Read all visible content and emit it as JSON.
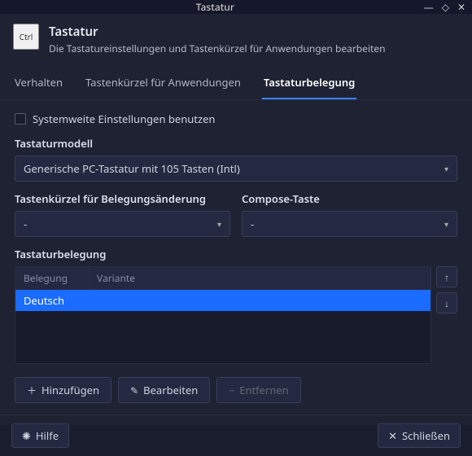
{
  "window": {
    "title": "Tastatur"
  },
  "header": {
    "icon_label": "Ctrl",
    "title": "Tastatur",
    "subtitle": "Die Tastatureinstellungen und Tastenkürzel für Anwendungen bearbeiten"
  },
  "tabs": [
    {
      "label": "Verhalten"
    },
    {
      "label": "Tastenkürzel für Anwendungen"
    },
    {
      "label": "Tastaturbelegung"
    }
  ],
  "active_tab": 2,
  "checkbox": {
    "label": "Systemweite Einstellungen benutzen",
    "checked": false
  },
  "model": {
    "label": "Tastaturmodell",
    "value": "Generische PC-Tastatur mit 105 Tasten (Intl)"
  },
  "shortcut": {
    "label": "Tastenkürzel für Belegungsänderung",
    "value": "-"
  },
  "compose": {
    "label": "Compose-Taste",
    "value": "-"
  },
  "layout_section": {
    "label": "Tastaturbelegung",
    "columns": {
      "belegung": "Belegung",
      "variante": "Variante"
    },
    "rows": [
      {
        "belegung": "Deutsch",
        "variante": ""
      }
    ]
  },
  "buttons": {
    "add": "Hinzufügen",
    "edit": "Bearbeiten",
    "remove": "Entfernen",
    "help": "Hilfe",
    "close": "Schließen"
  }
}
